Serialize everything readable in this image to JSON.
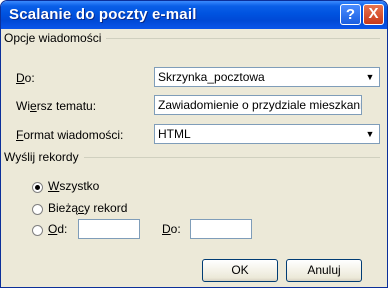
{
  "window": {
    "title": "Scalanie do poczty e-mail",
    "help_label": "?",
    "close_label": "X"
  },
  "message_options": {
    "group_title": "Opcje wiadomości",
    "to": {
      "label_accel": "D",
      "label_rest": "o:",
      "value": "Skrzynka_pocztowa"
    },
    "subject": {
      "label_pre": "Wi",
      "label_accel": "e",
      "label_post": "rsz tematu:",
      "value": "Zawiadomienie o przydziale mieszkania"
    },
    "format": {
      "label_accel": "F",
      "label_rest": "ormat wiadomości:",
      "value": "HTML"
    },
    "dropdown_arrow": "▼"
  },
  "send_records": {
    "group_title": "Wyślij rekordy",
    "all": {
      "label_accel": "W",
      "label_rest": "szystko",
      "checked": true
    },
    "current": {
      "label_pre": "Bieżą",
      "label_accel": "c",
      "label_post": "y rekord",
      "checked": false
    },
    "from": {
      "label_accel": "O",
      "label_rest": "d:",
      "value": ""
    },
    "to": {
      "label_accel": "D",
      "label_rest": "o:",
      "value": ""
    }
  },
  "buttons": {
    "ok": "OK",
    "cancel": "Anuluj"
  }
}
